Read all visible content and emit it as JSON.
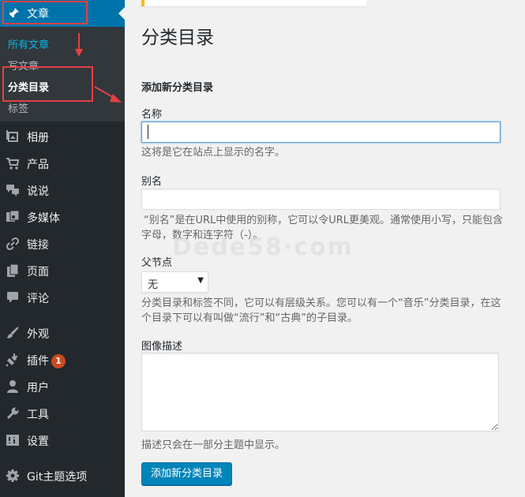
{
  "sidebar": {
    "posts": {
      "label": "文章"
    },
    "submenu": [
      {
        "label": "所有文章"
      },
      {
        "label": "写文章"
      },
      {
        "label": "分类目录"
      },
      {
        "label": "标签"
      }
    ],
    "items": [
      {
        "label": "相册",
        "icon": "gallery-icon"
      },
      {
        "label": "产品",
        "icon": "cart-icon"
      },
      {
        "label": "说说",
        "icon": "chat-icon"
      },
      {
        "label": "多媒体",
        "icon": "media-icon"
      },
      {
        "label": "链接",
        "icon": "link-icon"
      },
      {
        "label": "页面",
        "icon": "page-icon"
      },
      {
        "label": "评论",
        "icon": "comment-icon"
      },
      {
        "label": "外观",
        "icon": "paintbrush-icon"
      },
      {
        "label": "插件",
        "icon": "plugin-icon",
        "badge": "1"
      },
      {
        "label": "用户",
        "icon": "user-icon"
      },
      {
        "label": "工具",
        "icon": "wrench-icon"
      },
      {
        "label": "设置",
        "icon": "settings-icon"
      },
      {
        "label": "Git主题选项",
        "icon": "gear-icon"
      }
    ]
  },
  "main": {
    "title": "分类目录",
    "form": {
      "section_title": "添加新分类目录",
      "name": {
        "label": "名称",
        "value": "",
        "help": "这将是它在站点上显示的名字。"
      },
      "slug": {
        "label": "别名",
        "value": "",
        "help_line1": "“别名”是在URL中使用的别称，它可以令URL更美观。通常使用小写，只能包含",
        "help_line2": "字母，数字和连字符（-）。"
      },
      "parent": {
        "label": "父节点",
        "selected": "无",
        "help_line1": "分类目录和标签不同，它可以有层级关系。您可以有一个“音乐”分类目录，在这",
        "help_line2": "个目录下可以有叫做“流行”和“古典”的子目录。"
      },
      "description": {
        "label": "图像描述",
        "value": "",
        "help": "描述只会在一部分主题中显示。"
      },
      "submit_label": "添加新分类目录"
    }
  },
  "watermark": "Dede58·com",
  "colors": {
    "sidebar_bg": "#23282d",
    "submenu_bg": "#32373c",
    "active_blue": "#0073aa",
    "current_link": "#00b9eb",
    "badge": "#ca4a1f",
    "annotation_red": "#e64040",
    "notice_yellow": "#ffb900"
  }
}
